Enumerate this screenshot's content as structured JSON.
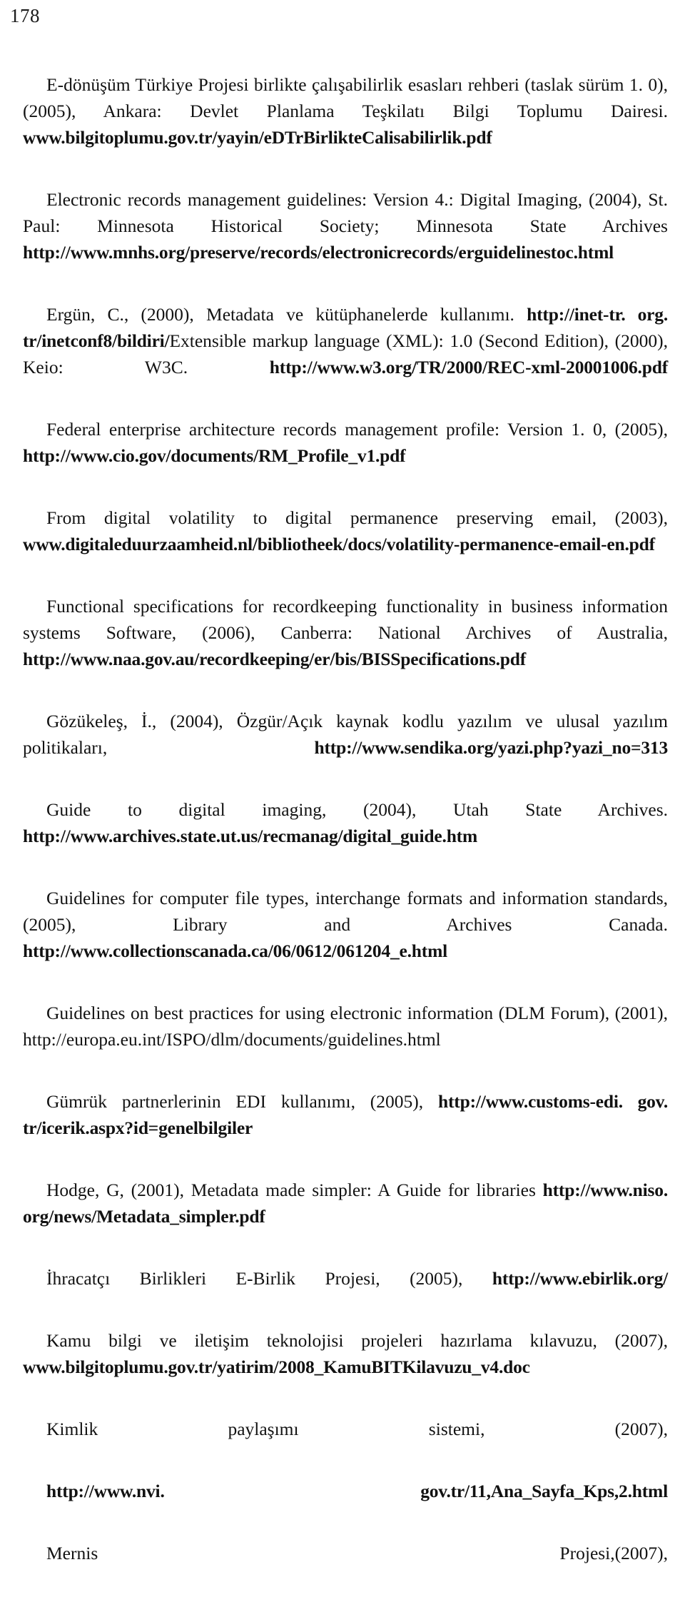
{
  "page": {
    "number": "178",
    "language": "tr",
    "type": "bibliography"
  },
  "references": [
    {
      "id": "ref-edonusum-turkiye",
      "segments": [
        {
          "weight": "regular",
          "text": "E-dönüşüm Türkiye Projesi birlikte çalışabilirlik esasları rehberi (taslak sürüm 1. 0), (2005), Ankara: Devlet Planlama Teşkilatı Bilgi Toplumu Dairesi. "
        },
        {
          "weight": "bold",
          "text": "www.bilgitoplumu.gov.tr/yayin/eDTrBirlikteCalisabilirlik.pdf"
        }
      ]
    },
    {
      "id": "ref-electronic-records-management",
      "segments": [
        {
          "weight": "regular",
          "text": "Electronic records management guidelines: Version 4.: Digital Imaging, (2004), St. Paul: Minnesota Historical Society; Minnesota State Archives "
        },
        {
          "weight": "bold",
          "text": "http://www.mnhs.org/preserve/records/electronicrecords/erguidelinestoc.html"
        }
      ]
    },
    {
      "id": "ref-ergun-metadata",
      "segments": [
        {
          "weight": "regular",
          "text": "Ergün, C., (2000), Metadata ve kütüphanelerde kullanımı. "
        },
        {
          "weight": "bold",
          "text": "http://inet-tr. org. tr/inetconf8/bildiri/"
        },
        {
          "weight": "regular",
          "text": "Extensible markup language (XML): 1.0 (Second Edition), (2000), Keio: W3C. "
        },
        {
          "weight": "bold",
          "text": "http://www.w3.org/TR/2000/REC-xml-20001006.pdf"
        }
      ]
    },
    {
      "id": "ref-federal-enterprise-architecture",
      "segments": [
        {
          "weight": "regular",
          "text": "Federal enterprise architecture records management profile: Version 1. 0, (2005), "
        },
        {
          "weight": "bold",
          "text": "http://www.cio.gov/documents/RM_Profile_v1.pdf"
        }
      ]
    },
    {
      "id": "ref-from-digital-volatility",
      "segments": [
        {
          "weight": "regular",
          "text": "From digital volatility to digital permanence preserving email, (2003), "
        },
        {
          "weight": "bold",
          "text": "www.digitaleduurzaamheid.nl/bibliotheek/docs/volatility-permanence-email-en.pdf"
        }
      ]
    },
    {
      "id": "ref-functional-specifications",
      "segments": [
        {
          "weight": "regular",
          "text": "Functional specifications for recordkeeping functionality in business information systems Software, (2006), Canberra: National Archives of Australia, "
        },
        {
          "weight": "bold",
          "text": "http://www.naa.gov.au/recordkeeping/er/bis/BISSpecifications.pdf"
        }
      ]
    },
    {
      "id": "ref-gozukeles",
      "segments": [
        {
          "weight": "regular",
          "text": "Gözükeleş, İ., (2004), Özgür/Açık kaynak kodlu yazılım ve ulusal yazılım politikaları, "
        },
        {
          "weight": "bold",
          "text": "http://www.sendika.org/yazi.php?yazi_no=313"
        }
      ]
    },
    {
      "id": "ref-guide-digital-imaging",
      "segments": [
        {
          "weight": "regular",
          "text": "Guide to digital imaging, (2004), Utah State Archives. "
        },
        {
          "weight": "bold",
          "text": "http://www.archives.state.ut.us/recmanag/digital_guide.htm"
        }
      ]
    },
    {
      "id": "ref-guidelines-computer-file-types",
      "segments": [
        {
          "weight": "regular",
          "text": "Guidelines for computer file types, interchange formats and information standards, (2005), Library and Archives Canada. "
        },
        {
          "weight": "bold",
          "text": "http://www.collectionscanada.ca/06/0612/061204_e.html"
        }
      ]
    },
    {
      "id": "ref-guidelines-best-practices-dlm",
      "segments": [
        {
          "weight": "regular",
          "text": "Guidelines on best practices for using electronic information (DLM Forum), (2001), http://europa.eu.int/ISPO/dlm/documents/guidelines.html"
        }
      ]
    },
    {
      "id": "ref-gumruk-edi",
      "segments": [
        {
          "weight": "regular",
          "text": "Gümrük partnerlerinin EDI kullanımı, (2005), "
        },
        {
          "weight": "bold",
          "text": "http://www.customs-edi. gov. tr/icerik.aspx?id=genelbilgiler"
        }
      ]
    },
    {
      "id": "ref-hodge-metadata",
      "segments": [
        {
          "weight": "regular",
          "text": "Hodge, G, (2001), Metadata made simpler: A Guide for libraries "
        },
        {
          "weight": "bold",
          "text": "http://www.niso. org/news/Metadata_simpler.pdf"
        }
      ]
    },
    {
      "id": "ref-ihracatci-birlikleri",
      "segments": [
        {
          "weight": "regular",
          "text": "İhracatçı Birlikleri E-Birlik Projesi, (2005), "
        },
        {
          "weight": "bold",
          "text": "http://www.ebirlik.org/"
        }
      ]
    },
    {
      "id": "ref-kamu-bilgi",
      "segments": [
        {
          "weight": "regular",
          "text": "Kamu bilgi ve iletişim teknolojisi projeleri hazırlama kılavuzu, (2007), "
        },
        {
          "weight": "bold",
          "text": "www.bilgitoplumu.gov.tr/yatirim/2008_KamuBITKilavuzu_v4.doc"
        }
      ]
    },
    {
      "id": "ref-kimlik-paylasimi",
      "segments": [
        {
          "weight": "regular",
          "text": "Kimlik paylaşımı sistemi, (2007),"
        }
      ]
    },
    {
      "id": "ref-kimlik-paylasimi-url",
      "noindent": false,
      "segments": [
        {
          "weight": "bold",
          "text": "http://www.nvi. gov.tr/11,Ana_Sayfa_Kps,2.html"
        }
      ]
    },
    {
      "id": "ref-mernis-projesi",
      "segments": [
        {
          "weight": "regular",
          "text": "Mernis Projesi,(2007),"
        }
      ]
    }
  ]
}
